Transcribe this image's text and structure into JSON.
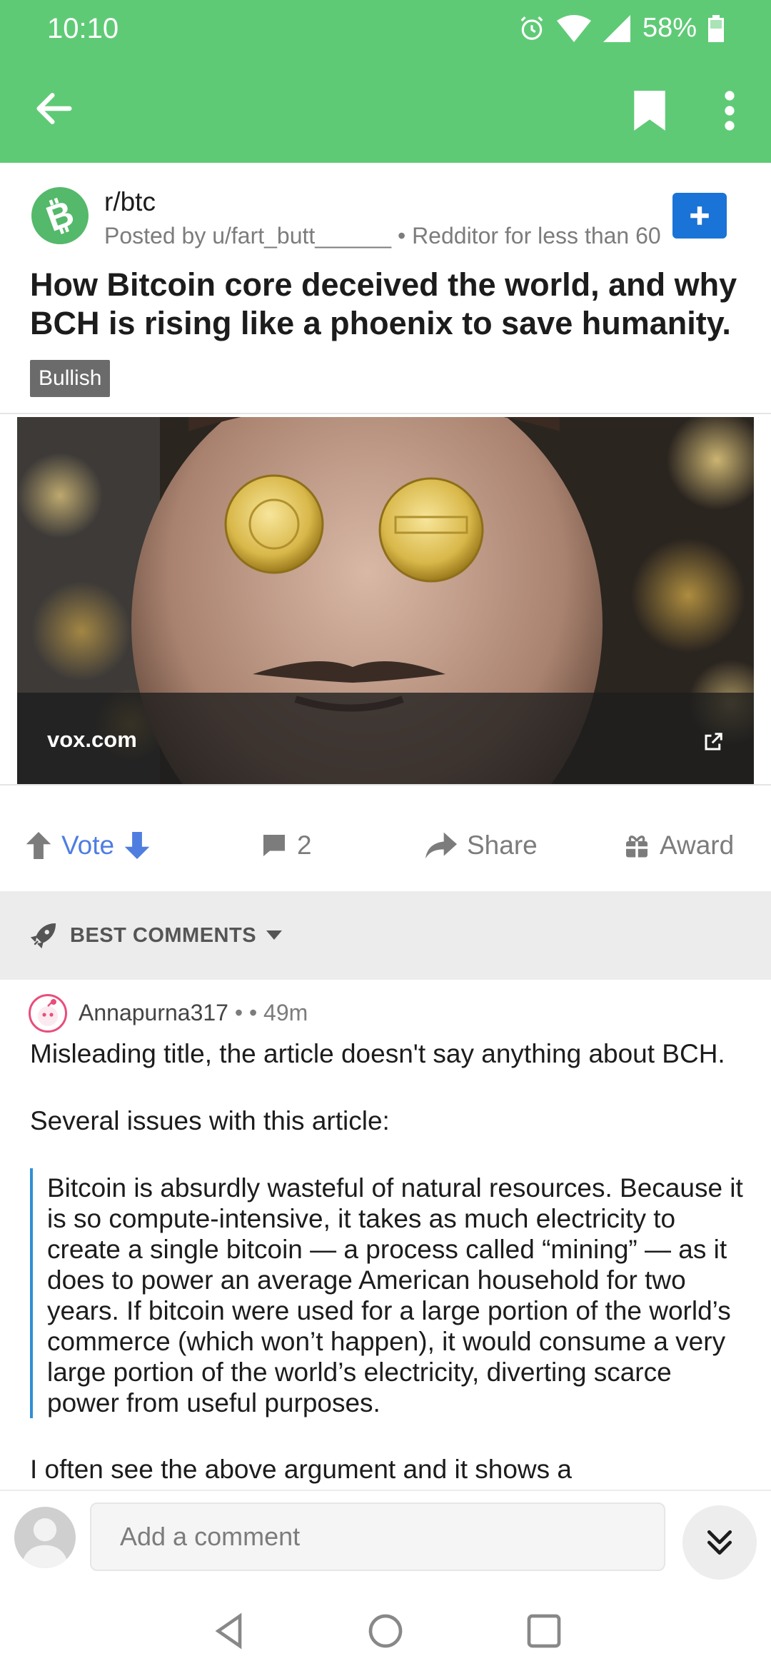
{
  "status_bar": {
    "time": "10:10",
    "battery": "58%"
  },
  "app_bar": {
    "back_icon": "arrow-left-icon",
    "bookmark_icon": "bookmark-icon",
    "more_icon": "more-vertical-icon"
  },
  "post": {
    "subreddit": "r/btc",
    "meta": "Posted by u/fart_butt______ • Redditor for less than 60 ...",
    "title": "How Bitcoin core deceived the world, and why BCH is rising like a phoenix to save humanity.",
    "flair": "Bullish",
    "link_domain": "vox.com"
  },
  "actions": {
    "vote": "Vote",
    "comments": "2",
    "share": "Share",
    "award": "Award"
  },
  "sort": {
    "label": "BEST COMMENTS"
  },
  "comment": {
    "author": "Annapurna317",
    "meta": "•   • 49m",
    "line1": "Misleading title, the article doesn't say anything about BCH.",
    "line2": "Several issues with this article:",
    "quote": "Bitcoin is absurdly wasteful of natural resources. Because it is so compute-intensive, it takes as much electricity to create a single bitcoin — a process called “mining” — as it does to power an average American household for two years. If bitcoin were used for a large portion of the world’s commerce (which won’t happen), it would consume a very large portion of the world’s electricity, diverting scarce power from useful purposes.",
    "line3": "I often see the above argument and it shows a"
  },
  "comment_input": {
    "placeholder": "Add a comment"
  },
  "colors": {
    "app_bar": "#5fca76",
    "join_button": "#1a73d6",
    "vote_accent": "#4f7ee0",
    "quote_bar": "#2f8fd6"
  }
}
